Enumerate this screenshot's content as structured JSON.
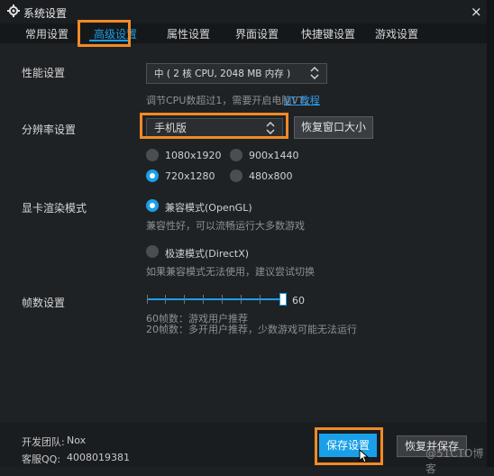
{
  "window": {
    "title": "系统设置",
    "close_symbol": "×"
  },
  "tabs": [
    {
      "label": "常用设置"
    },
    {
      "label": "高级设置"
    },
    {
      "label": "属性设置"
    },
    {
      "label": "界面设置"
    },
    {
      "label": "快捷键设置"
    },
    {
      "label": "游戏设置"
    }
  ],
  "performance": {
    "label": "性能设置",
    "select_value": "中 ( 2 核 CPU, 2048 MB 内存 )",
    "hint": "调节CPU数超过1，需要开启电脑VT。",
    "link": "VT 教程"
  },
  "resolution": {
    "label": "分辨率设置",
    "select_value": "手机版",
    "reset_button": "恢复窗口大小",
    "options": [
      "1080x1920",
      "900x1440",
      "720x1280",
      "480x800"
    ]
  },
  "render": {
    "label": "显卡渲染模式",
    "compat": {
      "label": "兼容模式(OpenGL)",
      "desc": "兼容性好，可以流畅运行大多数游戏"
    },
    "speed": {
      "label": "极速模式(DirectX)",
      "desc": "如果兼容模式无法使用，建议尝试切换"
    }
  },
  "fps": {
    "label": "帧数设置",
    "value": "60",
    "hint1": "60帧数：游戏用户推荐",
    "hint2": "20帧数：多开用户推荐，少数游戏可能无法运行"
  },
  "footer": {
    "dev_team_label": "开发团队:",
    "dev_team_value": "Nox",
    "qq_label": "客服QQ:",
    "qq_value": "4008019381",
    "save_button": "保存设置",
    "reset_save_button": "恢复并保存",
    "watermark": "@51CTO博客"
  },
  "colors": {
    "accent": "#1aa0e8",
    "highlight": "#f08a26"
  }
}
